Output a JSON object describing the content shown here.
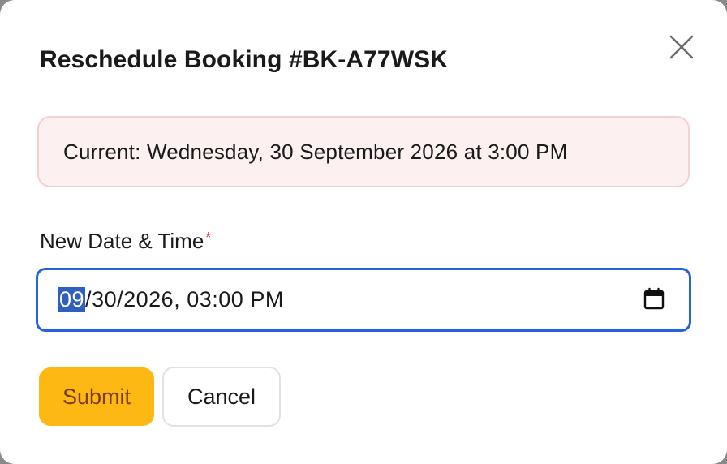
{
  "dialog": {
    "title": "Reschedule Booking #BK-A77WSK",
    "close_icon": "close-icon"
  },
  "current_booking": {
    "text": "Current: Wednesday, 30 September 2026 at 3:00 PM"
  },
  "new_datetime": {
    "label": "New Date & Time",
    "required_marker": "*",
    "value": {
      "month": "09",
      "sep1": "/",
      "day": "30",
      "sep2": "/",
      "year": "2026",
      "sep3": ", ",
      "hour": "03",
      "sep4": ":",
      "minute": "00",
      "sep5": " ",
      "ampm": "PM"
    },
    "selected_segment": "month",
    "calendar_icon": "calendar-icon"
  },
  "actions": {
    "submit_label": "Submit",
    "cancel_label": "Cancel"
  },
  "colors": {
    "submit_bg": "#fdb813",
    "submit_text": "#7a3b09",
    "focus_border": "#2463d9",
    "current_bg": "#fdf0f0",
    "current_border": "#f6cfd0",
    "required": "#e53935"
  }
}
